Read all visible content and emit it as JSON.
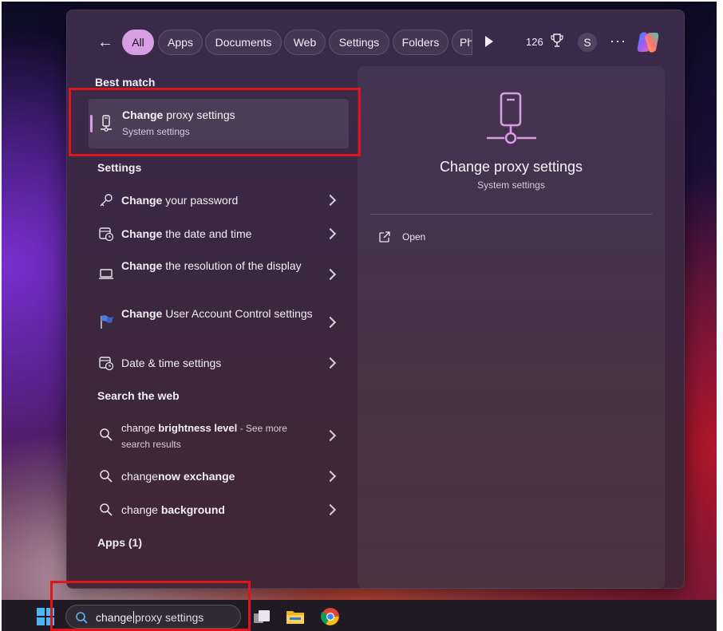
{
  "filters": [
    {
      "label": "All",
      "active": true
    },
    {
      "label": "Apps"
    },
    {
      "label": "Documents"
    },
    {
      "label": "Web"
    },
    {
      "label": "Settings"
    },
    {
      "label": "Folders"
    },
    {
      "label": "Ph"
    }
  ],
  "header": {
    "points": "126",
    "avatar_initial": "S",
    "more": "···"
  },
  "best_match": {
    "section_label": "Best match",
    "title_bold": "Change",
    "title_rest": " proxy settings",
    "subtitle": "System settings"
  },
  "settings_section": {
    "label": "Settings",
    "items": [
      {
        "bold": "Change",
        "rest": " your password",
        "icon": "key-icon"
      },
      {
        "bold": "Change",
        "rest": " the date and time",
        "icon": "calendar-clock-icon"
      },
      {
        "bold": "Change",
        "rest": " the resolution of the display",
        "icon": "laptop-icon"
      },
      {
        "bold": "Change",
        "rest": " User Account Control settings",
        "icon": "uac-flag-icon"
      },
      {
        "bold": "",
        "rest": "Date & time settings",
        "icon": "calendar-clock-icon"
      }
    ]
  },
  "web_section": {
    "label": "Search the web",
    "items": [
      {
        "plain": "change ",
        "bold": "brightness level",
        "suffix": " - See more",
        "sub": "search results"
      },
      {
        "plain": "change",
        "bold": "now exchange",
        "suffix": "",
        "sub": ""
      },
      {
        "plain": "change ",
        "bold": "background",
        "suffix": "",
        "sub": ""
      }
    ]
  },
  "apps_section": {
    "label": "Apps (1)"
  },
  "detail": {
    "title": "Change proxy settings",
    "subtitle": "System settings",
    "open_label": "Open"
  },
  "taskbar": {
    "search_typed": "change",
    "search_suggestion": "proxy settings"
  },
  "colors": {
    "accent": "#d79ee4",
    "highlight_box": "#e0151c"
  }
}
